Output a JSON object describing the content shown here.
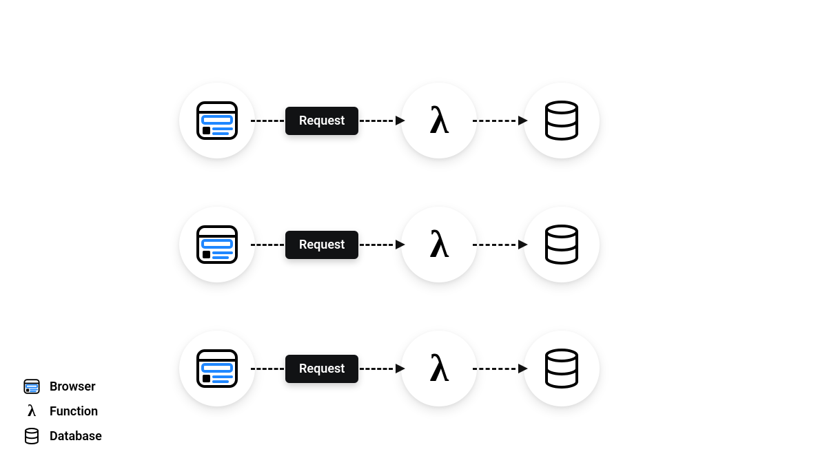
{
  "arrow_label": "Request",
  "rows": 3,
  "legend": {
    "browser": "Browser",
    "function": "Function",
    "database": "Database"
  },
  "colors": {
    "accent": "#1f87ff",
    "pill_bg": "#111214",
    "stroke": "#000000"
  }
}
